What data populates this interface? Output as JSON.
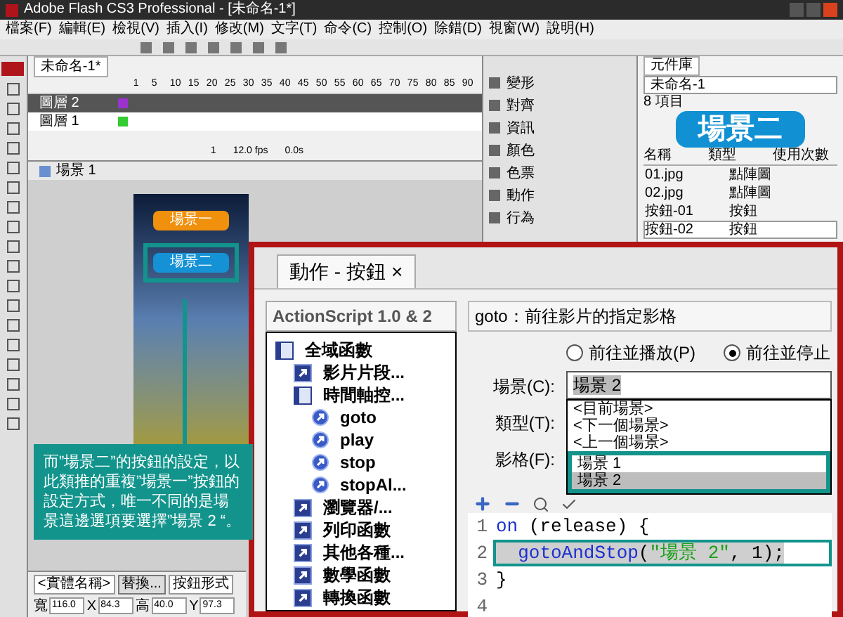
{
  "window": {
    "title": "Adobe Flash CS3 Professional - [未命名-1*]"
  },
  "menu": [
    "檔案(F)",
    "編輯(E)",
    "檢視(V)",
    "插入(I)",
    "修改(M)",
    "文字(T)",
    "命令(C)",
    "控制(O)",
    "除錯(D)",
    "視窗(W)",
    "說明(H)"
  ],
  "timeline": {
    "tab": "未命名-1*",
    "frames": [
      "1",
      "5",
      "10",
      "15",
      "20",
      "25",
      "30",
      "35",
      "40",
      "45",
      "50",
      "55",
      "60",
      "65",
      "70",
      "75",
      "80",
      "85",
      "90"
    ],
    "layers": [
      {
        "name": "圖層 2",
        "selected": true,
        "color": "#9933cc"
      },
      {
        "name": "圖層 1",
        "selected": false,
        "color": "#33cc33"
      }
    ],
    "status": [
      "1",
      "12.0 fps",
      "0.0s"
    ]
  },
  "scene_bar": {
    "scene": "場景 1"
  },
  "panel_buttons": [
    "變形",
    "對齊",
    "資訊",
    "顏色",
    "色票",
    "動作",
    "行為"
  ],
  "library": {
    "tab": "元件庫",
    "document": "未命名-1",
    "count": "8 項目",
    "preview": "場景二",
    "columns": [
      "名稱",
      "類型",
      "使用次數"
    ],
    "rows": [
      {
        "name": "01.jpg",
        "type": "點陣圖",
        "selected": false
      },
      {
        "name": "02.jpg",
        "type": "點陣圖",
        "selected": false
      },
      {
        "name": "按鈕-01",
        "type": "按鈕",
        "selected": false
      },
      {
        "name": "按鈕-02",
        "type": "按鈕",
        "selected": true
      }
    ]
  },
  "stage": {
    "buttons": [
      {
        "label": "場景一",
        "highlighted": false
      },
      {
        "label": "場景二",
        "highlighted": true
      }
    ]
  },
  "properties": {
    "instance": "<實體名稱>",
    "swap": "替換...",
    "behavior": "按鈕形式",
    "fields": [
      {
        "label": "寬",
        "value": "116.0"
      },
      {
        "label": "X",
        "value": "84.3"
      },
      {
        "label": "高",
        "value": "40.0"
      },
      {
        "label": "Y",
        "value": "97.3"
      }
    ]
  },
  "actions": {
    "tab": "動作 - 按鈕",
    "tab_close": "×",
    "version": "ActionScript 1.0 & 2",
    "tree": [
      {
        "label": "全域函數",
        "kind": "book",
        "children": [
          {
            "label": "影片片段...",
            "kind": "box"
          },
          {
            "label": "時間軸控...",
            "kind": "book",
            "children": [
              {
                "label": "goto",
                "kind": "circle"
              },
              {
                "label": "play",
                "kind": "circle"
              },
              {
                "label": "stop",
                "kind": "circle"
              },
              {
                "label": "stopAl...",
                "kind": "circle"
              }
            ]
          },
          {
            "label": "瀏覽器/...",
            "kind": "box"
          },
          {
            "label": "列印函數",
            "kind": "box"
          },
          {
            "label": "其他各種...",
            "kind": "box"
          },
          {
            "label": "數學函數",
            "kind": "box"
          },
          {
            "label": "轉換函數",
            "kind": "box"
          }
        ]
      }
    ],
    "header": "goto：前往影片的指定影格",
    "radios": [
      {
        "label": "前往並播放(P)",
        "selected": false
      },
      {
        "label": "前往並停止",
        "selected": true
      }
    ],
    "scene_label": "場景(C):",
    "scene_value": "場景 2",
    "type_label": "類型(T):",
    "frame_label": "影格(F):",
    "options": [
      {
        "label": "<目前場景>",
        "selected": false,
        "highlighted": false
      },
      {
        "label": "<下一個場景>",
        "selected": false,
        "highlighted": false
      },
      {
        "label": "<上一個場景>",
        "selected": false,
        "highlighted": false
      },
      {
        "label": "場景 1",
        "selected": false,
        "highlighted": true
      },
      {
        "label": "場景 2",
        "selected": true,
        "highlighted": true
      }
    ],
    "code": [
      {
        "highlighted": false,
        "tokens": [
          {
            "text": "on",
            "kind": "keyword"
          },
          {
            "text": " (release) {",
            "kind": "plain"
          }
        ]
      },
      {
        "highlighted": true,
        "tokens": [
          {
            "text": "  gotoAndStop",
            "kind": "keyword"
          },
          {
            "text": "(",
            "kind": "plain"
          },
          {
            "text": "\"場景 2\"",
            "kind": "string"
          },
          {
            "text": ", 1);",
            "kind": "plain"
          }
        ]
      },
      {
        "highlighted": false,
        "tokens": [
          {
            "text": "}",
            "kind": "plain"
          }
        ]
      }
    ],
    "line_numbers": [
      "1",
      "2",
      "3",
      "4"
    ]
  },
  "callout": "而”場景二”的按鈕的設定，以此類推的重複”場景一”按鈕的設定方式，唯一不同的是場景這邊選項要選擇”場景 2 “。"
}
